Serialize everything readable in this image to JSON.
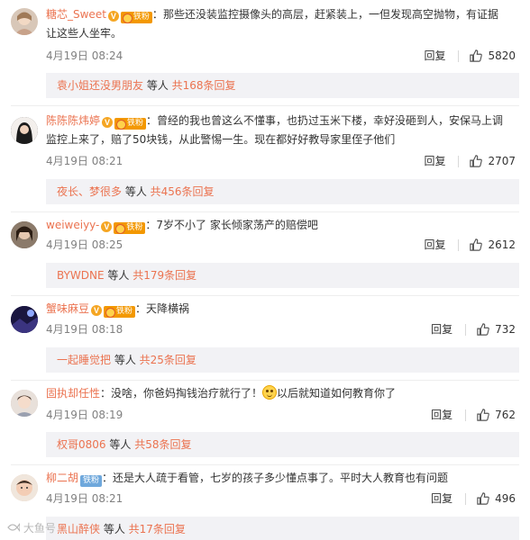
{
  "comments": [
    {
      "username": "糖芯_Sweet",
      "fan_badge": "铁粉",
      "text": "那些还没装监控摄像头的高层，赶紧装上，一但发现高空抛物，有证据让这些人坐牢。",
      "time": "4月19日 08:24",
      "reply_label": "回复",
      "likes": "5820",
      "replies": {
        "who": "袁小姐还没男朋友",
        "mid": " 等人 ",
        "total": "共168条回复"
      },
      "avatar_color": "#d8c7b8"
    },
    {
      "username": "陈陈陈炜婷",
      "fan_badge": "铁粉",
      "text": "曾经的我也曾这么不懂事，也扔过玉米下楼，幸好没砸到人，安保马上调监控上来了，赔了50块钱，从此警惕一生。现在都好好教导家里侄子他们",
      "time": "4月19日 08:21",
      "reply_label": "回复",
      "likes": "2707",
      "replies": {
        "who": "夜长、梦很多",
        "mid": " 等人 ",
        "total": "共456条回复"
      },
      "avatar_color": "#3a3a3a"
    },
    {
      "username": "weiweiyy-",
      "fan_badge": "铁粉",
      "text": "7岁不小了 家长倾家荡产的赔偿吧",
      "time": "4月19日 08:25",
      "reply_label": "回复",
      "likes": "2612",
      "replies": {
        "who": "BYWDNE",
        "mid": " 等人 ",
        "total": "共179条回复"
      },
      "avatar_color": "#6b5a4a"
    },
    {
      "username": "蟹味麻豆",
      "fan_badge": "铁粉",
      "text": "天降横祸",
      "time": "4月19日 08:18",
      "reply_label": "回复",
      "likes": "732",
      "replies": {
        "who": "一起睡觉把",
        "mid": " 等人 ",
        "total": "共25条回复"
      },
      "avatar_color": "#2b2450"
    },
    {
      "username": "固执却任性",
      "text_before": "没啥，你爸妈掏钱治疗就行了！",
      "text_after": "以后就知道如何教育你了",
      "time": "4月19日 08:19",
      "reply_label": "回复",
      "likes": "762",
      "replies": {
        "who": "权哥0806",
        "mid": " 等人 ",
        "total": "共58条回复"
      },
      "avatar_color": "#cbbab0"
    },
    {
      "username": "柳二胡",
      "fan_badge": "铁粉",
      "text": "还是大人疏于看管，七岁的孩子多少懂点事了。平时大人教育也有问题",
      "time": "4月19日 08:21",
      "reply_label": "回复",
      "likes": "496",
      "replies": {
        "who": "黑山醉侠",
        "mid": " 等人 ",
        "total": "共17条回复"
      },
      "avatar_color": "#e2c4b0"
    }
  ],
  "watermark": "大鱼号"
}
